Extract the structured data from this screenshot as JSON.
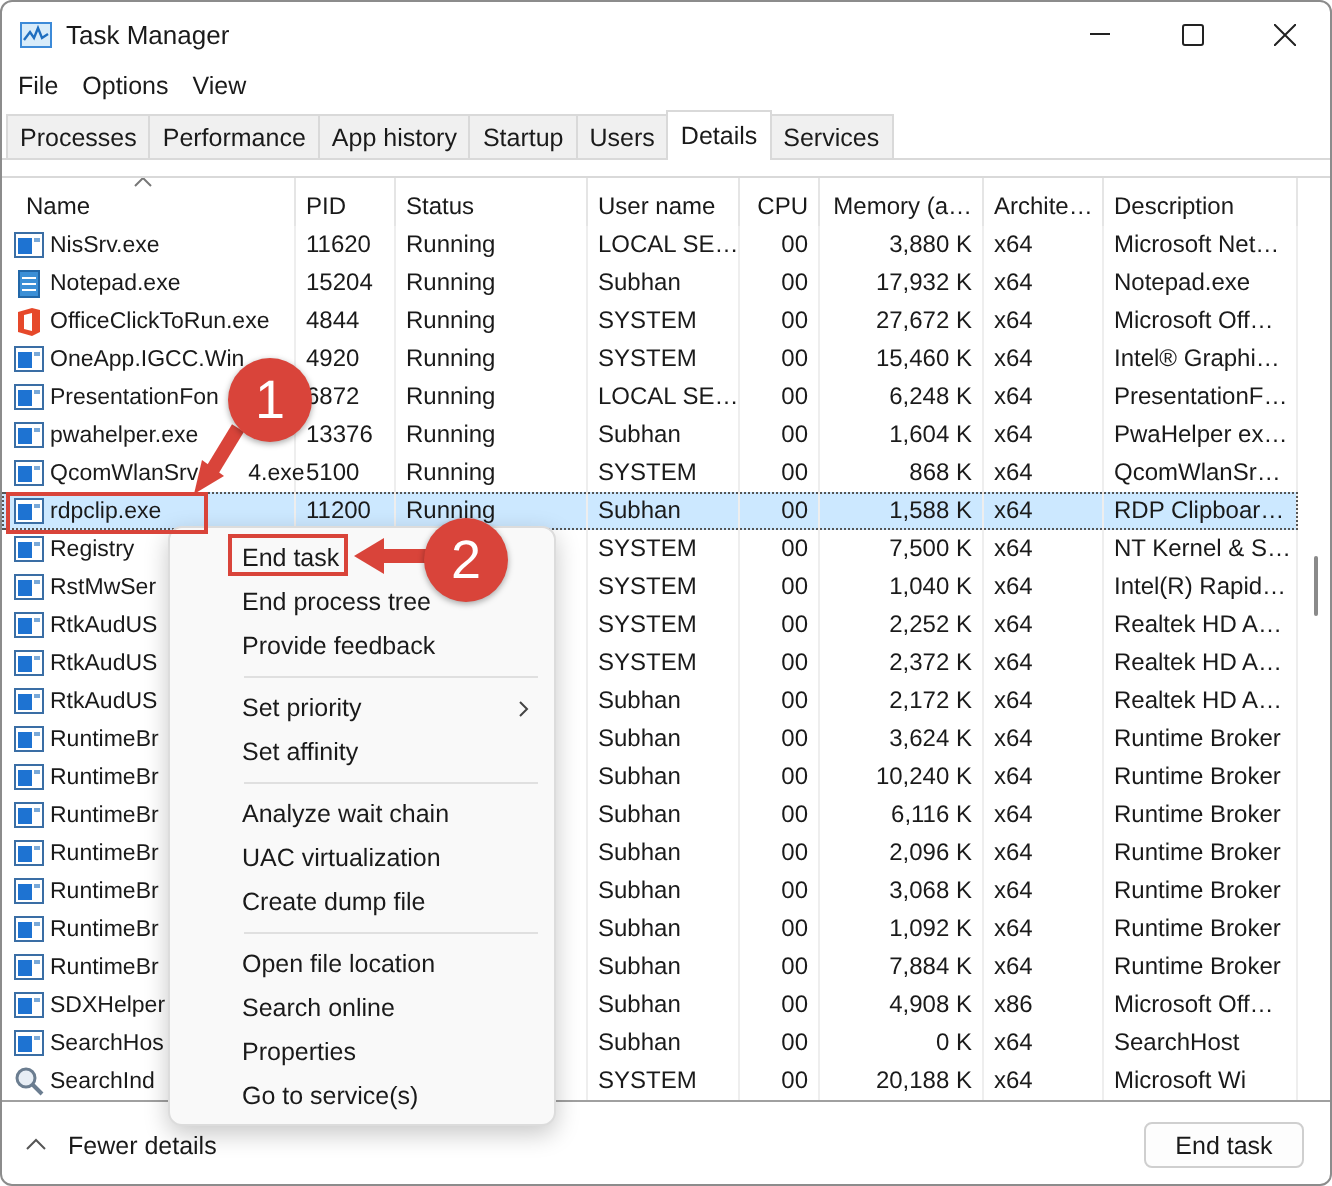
{
  "window": {
    "title": "Task Manager"
  },
  "menu_bar": [
    "File",
    "Options",
    "View"
  ],
  "tabs": [
    {
      "label": "Processes",
      "selected": false
    },
    {
      "label": "Performance",
      "selected": false
    },
    {
      "label": "App history",
      "selected": false
    },
    {
      "label": "Startup",
      "selected": false
    },
    {
      "label": "Users",
      "selected": false
    },
    {
      "label": "Details",
      "selected": true
    },
    {
      "label": "Services",
      "selected": false
    }
  ],
  "table": {
    "columns": [
      {
        "label": "Name",
        "sorted": true
      },
      {
        "label": "PID",
        "sorted": false
      },
      {
        "label": "Status",
        "sorted": false
      },
      {
        "label": "User name",
        "sorted": false
      },
      {
        "label": "CPU",
        "sorted": false
      },
      {
        "label": "Memory (a…",
        "sorted": false
      },
      {
        "label": "Archite…",
        "sorted": false
      },
      {
        "label": "Description",
        "sorted": false
      }
    ],
    "rows": [
      {
        "kind": "app",
        "name": "NisSrv.exe",
        "pid": "11620",
        "status": "Running",
        "user_name": "LOCAL SE…",
        "cpu": "00",
        "memory": "3,880 K",
        "architecture": "x64",
        "description": "Microsoft Net…",
        "selected": false
      },
      {
        "kind": "notepad",
        "name": "Notepad.exe",
        "pid": "15204",
        "status": "Running",
        "user_name": "Subhan",
        "cpu": "00",
        "memory": "17,932 K",
        "architecture": "x64",
        "description": "Notepad.exe",
        "selected": false
      },
      {
        "kind": "office",
        "name": "OfficeClickToRun.exe",
        "pid": "4844",
        "status": "Running",
        "user_name": "SYSTEM",
        "cpu": "00",
        "memory": "27,672 K",
        "architecture": "x64",
        "description": "Microsoft Off…",
        "selected": false
      },
      {
        "kind": "app",
        "name": "OneApp.IGCC.Win",
        "pid": "4920",
        "status": "Running",
        "user_name": "SYSTEM",
        "cpu": "00",
        "memory": "15,460 K",
        "architecture": "x64",
        "description": "Intel® Graphi…",
        "selected": false
      },
      {
        "kind": "app",
        "name": "PresentationFon",
        "pid": "6872",
        "status": "Running",
        "user_name": "LOCAL SE…",
        "cpu": "00",
        "memory": "6,248 K",
        "architecture": "x64",
        "description": "PresentationF…",
        "selected": false
      },
      {
        "kind": "app",
        "name": "pwahelper.exe",
        "pid": "13376",
        "status": "Running",
        "user_name": "Subhan",
        "cpu": "00",
        "memory": "1,604 K",
        "architecture": "x64",
        "description": "PwaHelper ex…",
        "selected": false
      },
      {
        "kind": "app",
        "name": "QcomWlanSrv",
        "name_tail": "4.exe",
        "pid": "5100",
        "status": "Running",
        "user_name": "SYSTEM",
        "cpu": "00",
        "memory": "868 K",
        "architecture": "x64",
        "description": "QcomWlanSr…",
        "selected": false
      },
      {
        "kind": "app",
        "name": "rdpclip.exe",
        "pid": "11200",
        "status": "Running",
        "user_name": "Subhan",
        "cpu": "00",
        "memory": "1,588 K",
        "architecture": "x64",
        "description": "RDP Clipboar…",
        "selected": true
      },
      {
        "kind": "app",
        "name": "Registry",
        "user_name": "SYSTEM",
        "cpu": "00",
        "memory": "7,500 K",
        "architecture": "x64",
        "description": "NT Kernel & S…",
        "selected": false
      },
      {
        "kind": "app",
        "name": "RstMwSer",
        "user_name": "SYSTEM",
        "cpu": "00",
        "memory": "1,040 K",
        "architecture": "x64",
        "description": "Intel(R) Rapid…",
        "selected": false
      },
      {
        "kind": "app",
        "name": "RtkAudUS",
        "user_name": "SYSTEM",
        "cpu": "00",
        "memory": "2,252 K",
        "architecture": "x64",
        "description": "Realtek HD A…",
        "selected": false
      },
      {
        "kind": "app",
        "name": "RtkAudUS",
        "user_name": "SYSTEM",
        "cpu": "00",
        "memory": "2,372 K",
        "architecture": "x64",
        "description": "Realtek HD A…",
        "selected": false
      },
      {
        "kind": "app",
        "name": "RtkAudUS",
        "user_name": "Subhan",
        "cpu": "00",
        "memory": "2,172 K",
        "architecture": "x64",
        "description": "Realtek HD A…",
        "selected": false
      },
      {
        "kind": "app",
        "name": "RuntimeBr",
        "user_name": "Subhan",
        "cpu": "00",
        "memory": "3,624 K",
        "architecture": "x64",
        "description": "Runtime Broker",
        "selected": false
      },
      {
        "kind": "app",
        "name": "RuntimeBr",
        "user_name": "Subhan",
        "cpu": "00",
        "memory": "10,240 K",
        "architecture": "x64",
        "description": "Runtime Broker",
        "selected": false
      },
      {
        "kind": "app",
        "name": "RuntimeBr",
        "user_name": "Subhan",
        "cpu": "00",
        "memory": "6,116 K",
        "architecture": "x64",
        "description": "Runtime Broker",
        "selected": false
      },
      {
        "kind": "app",
        "name": "RuntimeBr",
        "user_name": "Subhan",
        "cpu": "00",
        "memory": "2,096 K",
        "architecture": "x64",
        "description": "Runtime Broker",
        "selected": false
      },
      {
        "kind": "app",
        "name": "RuntimeBr",
        "user_name": "Subhan",
        "cpu": "00",
        "memory": "3,068 K",
        "architecture": "x64",
        "description": "Runtime Broker",
        "selected": false
      },
      {
        "kind": "app",
        "name": "RuntimeBr",
        "user_name": "Subhan",
        "cpu": "00",
        "memory": "1,092 K",
        "architecture": "x64",
        "description": "Runtime Broker",
        "selected": false
      },
      {
        "kind": "app",
        "name": "RuntimeBr",
        "user_name": "Subhan",
        "cpu": "00",
        "memory": "7,884 K",
        "architecture": "x64",
        "description": "Runtime Broker",
        "selected": false
      },
      {
        "kind": "app",
        "name": "SDXHelper",
        "user_name": "Subhan",
        "cpu": "00",
        "memory": "4,908 K",
        "architecture": "x86",
        "description": "Microsoft Off…",
        "selected": false
      },
      {
        "kind": "app",
        "name": "SearchHos",
        "user_name": "Subhan",
        "cpu": "00",
        "memory": "0 K",
        "architecture": "x64",
        "description": "SearchHost",
        "selected": false
      },
      {
        "kind": "search",
        "name": "SearchInd",
        "user_name": "SYSTEM",
        "cpu": "00",
        "memory": "20,188 K",
        "architecture": "x64",
        "description": "Microsoft Wi",
        "selected": false
      }
    ]
  },
  "context_menu": {
    "groups": [
      [
        {
          "label": "End task",
          "submenu": false
        },
        {
          "label": "End process tree",
          "submenu": false
        },
        {
          "label": "Provide feedback",
          "submenu": false
        }
      ],
      [
        {
          "label": "Set priority",
          "submenu": true
        },
        {
          "label": "Set affinity",
          "submenu": false
        }
      ],
      [
        {
          "label": "Analyze wait chain",
          "submenu": false
        },
        {
          "label": "UAC virtualization",
          "submenu": false
        },
        {
          "label": "Create dump file",
          "submenu": false
        }
      ],
      [
        {
          "label": "Open file location",
          "submenu": false
        },
        {
          "label": "Search online",
          "submenu": false
        },
        {
          "label": "Properties",
          "submenu": false
        },
        {
          "label": "Go to service(s)",
          "submenu": false
        }
      ]
    ]
  },
  "footer": {
    "toggle": "Fewer details",
    "button": "End task"
  },
  "callouts": [
    {
      "label": "1"
    },
    {
      "label": "2"
    }
  ]
}
